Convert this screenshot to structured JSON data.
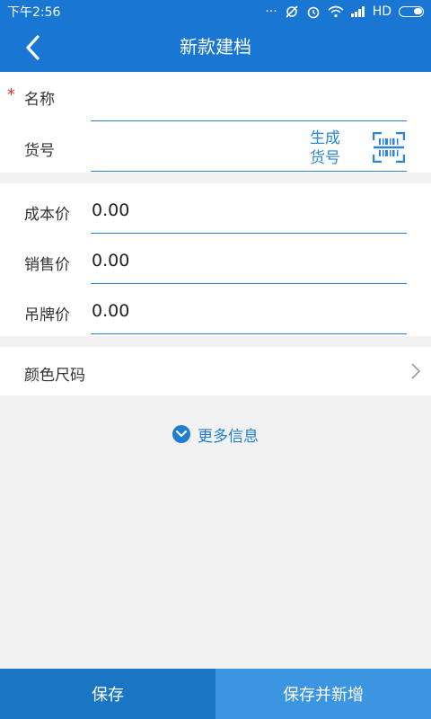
{
  "status_bar": {
    "time": "下午2:56",
    "network": "HD"
  },
  "header": {
    "title": "新款建档"
  },
  "basic": {
    "name_label": "名称",
    "required_mark": "*",
    "sku_label": "货号",
    "generate_label_line1": "生成",
    "generate_label_line2": "货号"
  },
  "prices": {
    "cost": {
      "label": "成本价",
      "value": "0.00"
    },
    "sale": {
      "label": "销售价",
      "value": "0.00"
    },
    "tag": {
      "label": "吊牌价",
      "value": "0.00"
    }
  },
  "color_size": {
    "label": "颜色尺码"
  },
  "more_info": {
    "label": "更多信息"
  },
  "footer": {
    "save": "保存",
    "save_new": "保存并新增"
  },
  "colors": {
    "primary": "#1976d2",
    "accent": "#2b86d6",
    "required": "#d9342b"
  },
  "icons": [
    "back-arrow-icon",
    "scan-barcode-icon",
    "chevron-right-icon",
    "chevron-down-circle-icon",
    "wifi-icon",
    "signal-icon",
    "battery-icon",
    "alarm-icon",
    "sync-off-icon"
  ]
}
